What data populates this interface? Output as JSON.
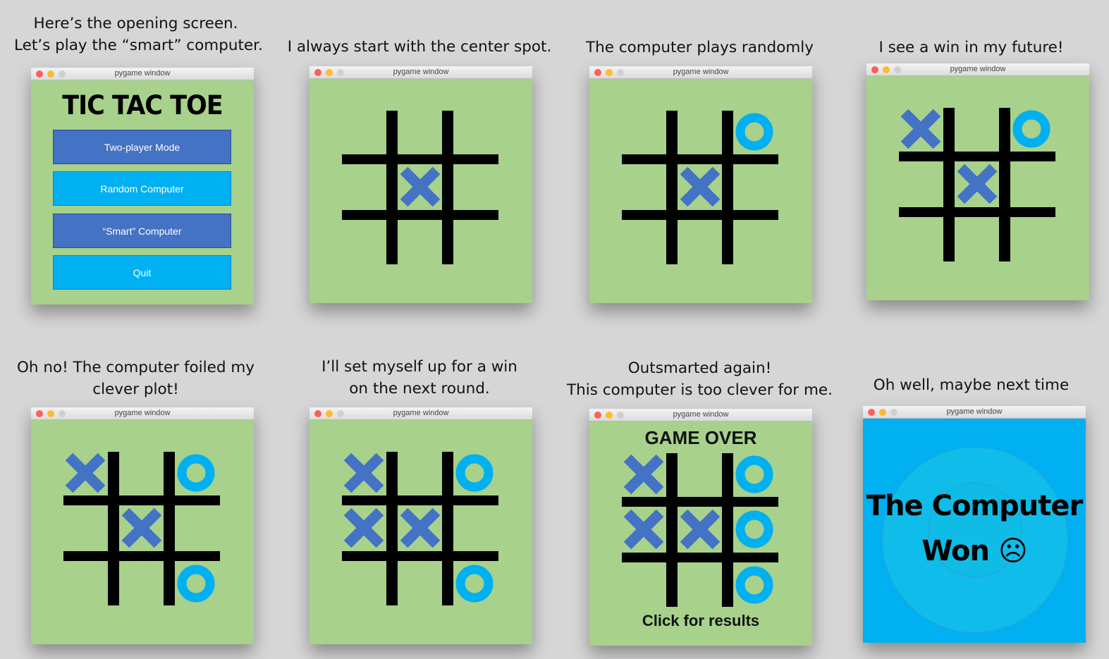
{
  "window_title": "pygame window",
  "colors": {
    "background": "#d6d6d6",
    "board": "#a8d18c",
    "x_mark": "#4472c4",
    "o_mark": "#00b0f0",
    "grid": "#000000"
  },
  "captions": [
    {
      "lines": [
        "Here’s the opening screen.",
        "Let’s play the “smart” computer."
      ]
    },
    {
      "lines": [
        "I always start with the center spot."
      ]
    },
    {
      "lines": [
        "The computer plays randomly"
      ]
    },
    {
      "lines": [
        "I see a win in my future!"
      ]
    },
    {
      "lines": [
        "Oh no! The computer foiled my",
        "clever plot!"
      ]
    },
    {
      "lines": [
        "I’ll set myself up for a win",
        "on the next round."
      ]
    },
    {
      "lines": [
        "Outsmarted again!",
        "This computer is too clever for me."
      ]
    },
    {
      "lines": [
        "Oh well, maybe next time"
      ]
    }
  ],
  "menu": {
    "title": "TIC TAC TOE",
    "buttons": [
      {
        "label": "Two-player Mode",
        "style": "dark"
      },
      {
        "label": "Random Computer",
        "style": "light"
      },
      {
        "label": "“Smart” Computer",
        "style": "dark"
      },
      {
        "label": "Quit",
        "style": "light"
      }
    ]
  },
  "boards": [
    {
      "cells": [
        "",
        "",
        "",
        "",
        "X",
        "",
        "",
        "",
        ""
      ]
    },
    {
      "cells": [
        "",
        "",
        "O",
        "",
        "X",
        "",
        "",
        "",
        ""
      ]
    },
    {
      "cells": [
        "X",
        "",
        "O",
        "",
        "X",
        "",
        "",
        "",
        ""
      ]
    },
    {
      "cells": [
        "X",
        "",
        "O",
        "",
        "X",
        "",
        "",
        "",
        "O"
      ]
    },
    {
      "cells": [
        "X",
        "",
        "O",
        "X",
        "X",
        "",
        "",
        "",
        "O"
      ]
    },
    {
      "cells": [
        "X",
        "",
        "O",
        "X",
        "X",
        "O",
        "",
        "",
        "O"
      ]
    }
  ],
  "game_over": {
    "title": "GAME OVER",
    "footer": "Click for results"
  },
  "result": {
    "line1": "The Computer",
    "line2": "Won ☹"
  }
}
